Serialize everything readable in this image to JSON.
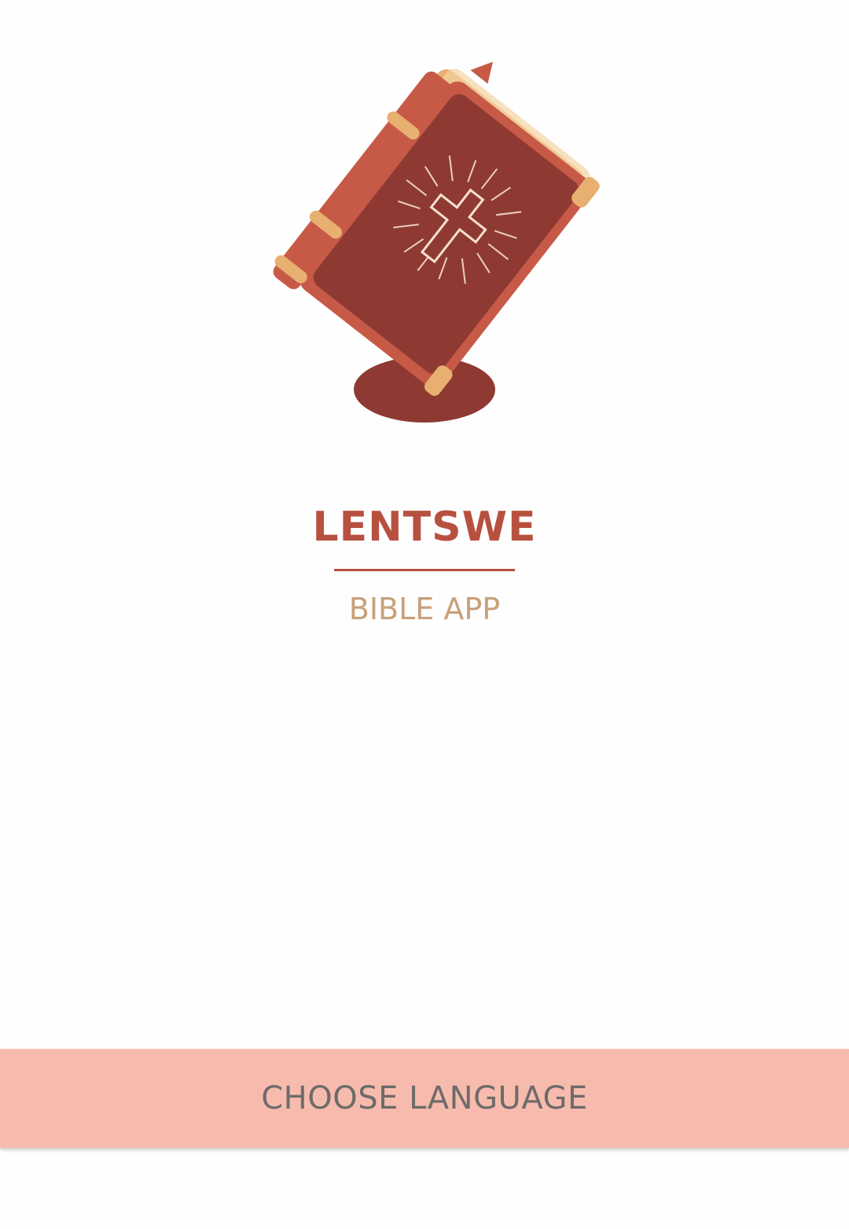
{
  "splash": {
    "app_name": "LENTSWE",
    "subtitle": "BIBLE APP"
  },
  "actions": {
    "choose_language_label": "CHOOSE LANGUAGE"
  },
  "logo": {
    "icon": "bible-icon"
  },
  "colors": {
    "primary": "#b85040",
    "accent": "#c8a07a",
    "button_bg": "#f7bbae",
    "button_text": "#6e6b69",
    "book_cover": "#8e3a32",
    "book_edge": "#c75a47",
    "gold": "#e8b070"
  }
}
